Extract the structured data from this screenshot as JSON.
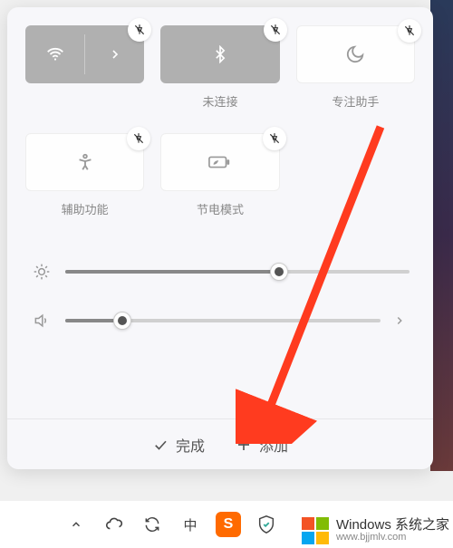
{
  "tiles": {
    "wifi": {
      "label": ""
    },
    "bluetooth": {
      "label": "未连接"
    },
    "focus": {
      "label": "专注助手"
    },
    "accessibility": {
      "label": "辅助功能"
    },
    "battery": {
      "label": "节电模式"
    }
  },
  "sliders": {
    "brightness": {
      "percent": 62
    },
    "volume": {
      "percent": 18
    }
  },
  "actions": {
    "done": "完成",
    "add": "添加"
  },
  "taskbar": {
    "ime": "中",
    "sogou": "S"
  },
  "watermark": {
    "line1": "Windows 系统之家",
    "line2": "www.bjjmlv.com"
  }
}
